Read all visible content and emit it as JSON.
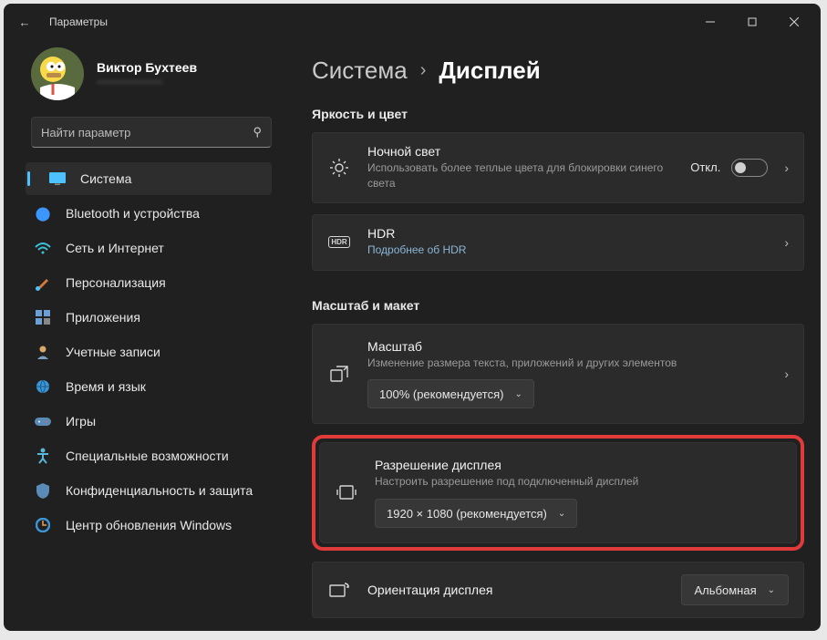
{
  "window": {
    "title": "Параметры"
  },
  "account": {
    "name": "Виктор Бухтеев",
    "email": "——————"
  },
  "search": {
    "placeholder": "Найти параметр"
  },
  "nav": [
    {
      "label": "Система",
      "selected": true
    },
    {
      "label": "Bluetooth и устройства"
    },
    {
      "label": "Сеть и Интернет"
    },
    {
      "label": "Персонализация"
    },
    {
      "label": "Приложения"
    },
    {
      "label": "Учетные записи"
    },
    {
      "label": "Время и язык"
    },
    {
      "label": "Игры"
    },
    {
      "label": "Специальные возможности"
    },
    {
      "label": "Конфиденциальность и защита"
    },
    {
      "label": "Центр обновления Windows"
    }
  ],
  "breadcrumb": {
    "root": "Система",
    "current": "Дисплей"
  },
  "sections": {
    "brightness": "Яркость и цвет",
    "scale": "Масштаб и макет"
  },
  "cards": {
    "nightlight": {
      "title": "Ночной свет",
      "desc": "Использовать более теплые цвета для блокировки синего света",
      "state": "Откл."
    },
    "hdr": {
      "title": "HDR",
      "desc": "Подробнее об HDR",
      "badge": "HDR"
    },
    "scale": {
      "title": "Масштаб",
      "desc": "Изменение размера текста, приложений и других элементов",
      "value": "100% (рекомендуется)"
    },
    "resolution": {
      "title": "Разрешение дисплея",
      "desc": "Настроить разрешение под подключенный дисплей",
      "value": "1920 × 1080 (рекомендуется)"
    },
    "orientation": {
      "title": "Ориентация дисплея",
      "value": "Альбомная"
    }
  }
}
